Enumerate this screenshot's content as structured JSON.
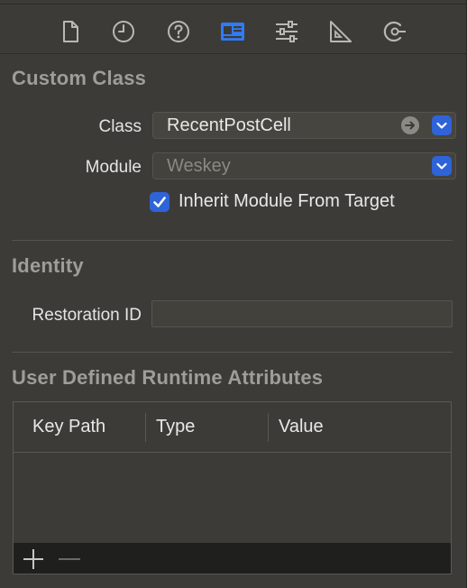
{
  "toolbar": {
    "icons": [
      {
        "name": "file-inspector-icon"
      },
      {
        "name": "history-inspector-icon"
      },
      {
        "name": "quick-help-icon"
      },
      {
        "name": "identity-inspector-icon",
        "selected": true
      },
      {
        "name": "attributes-inspector-icon"
      },
      {
        "name": "size-inspector-icon"
      },
      {
        "name": "connections-inspector-icon"
      }
    ],
    "accent_color": "#2f63d8"
  },
  "custom_class": {
    "title": "Custom Class",
    "class_label": "Class",
    "class_value": "RecentPostCell",
    "module_label": "Module",
    "module_placeholder": "Weskey",
    "inherit_label": "Inherit Module From Target",
    "inherit_checked": true
  },
  "identity": {
    "title": "Identity",
    "restoration_id_label": "Restoration ID",
    "restoration_id_value": ""
  },
  "runtime_attributes": {
    "title": "User Defined Runtime Attributes",
    "columns": [
      "Key Path",
      "Type",
      "Value"
    ],
    "rows": []
  }
}
